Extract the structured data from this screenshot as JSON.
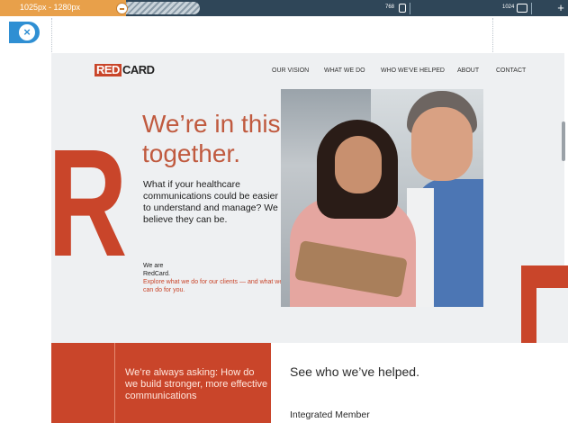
{
  "breakpoints": {
    "range_label": "1025px - 1280px",
    "mid_label": "768",
    "right_label": "1024"
  },
  "toolbar": {
    "add_label": "+",
    "close_label": "×"
  },
  "site": {
    "logo": {
      "red_part": "RED",
      "dark_part": "CARD"
    },
    "nav": [
      "OUR VISION",
      "WHAT WE DO",
      "WHO WE'VE HELPED",
      "ABOUT",
      "CONTACT"
    ],
    "big_letter": "R",
    "hero": {
      "title_line1": "We’re in this",
      "title_line2": "together.",
      "body": "What if your healthcare communications could be easier to understand and manage? We believe they can be.",
      "we_are_line1": "We are",
      "we_are_line2": "RedCard.",
      "explore": "Explore what we do for our clients — and what we can do for you."
    },
    "bottom": {
      "asking": "We’re always asking: How do we build stronger, more effective communications",
      "helped": "See who we’ve helped.",
      "integrated": "Integrated Member"
    }
  },
  "colors": {
    "brand_red": "#c9452a",
    "ruler_dark": "#2f4658",
    "ruler_orange": "#e8a04a",
    "close_blue": "#2f8fd3"
  }
}
